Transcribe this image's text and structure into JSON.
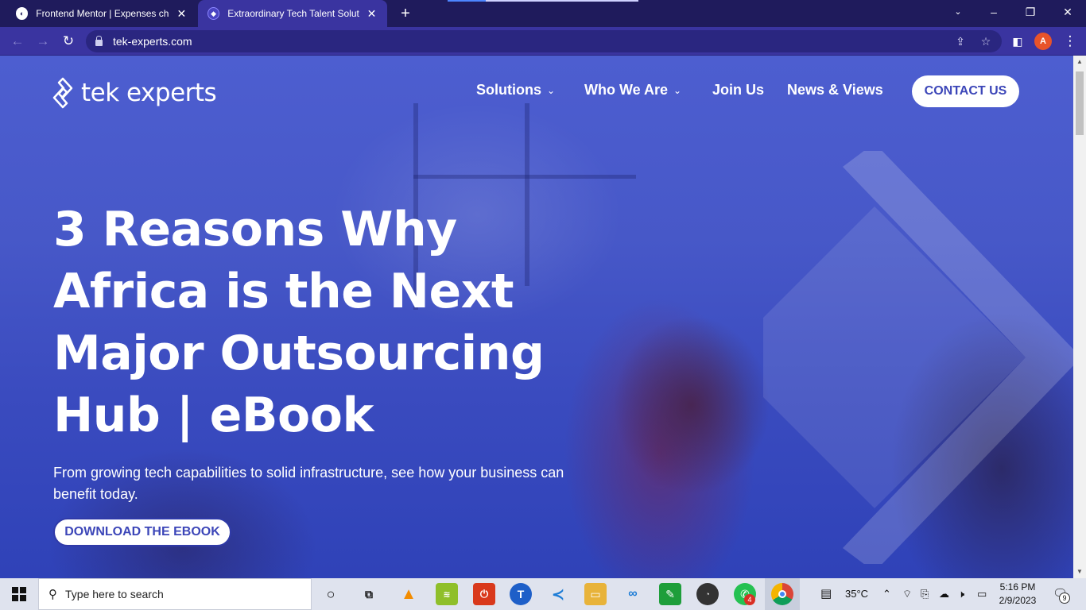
{
  "browser": {
    "tabs": [
      {
        "title": "Frontend Mentor | Expenses char",
        "active": false
      },
      {
        "title": "Extraordinary Tech Talent Solution",
        "active": true
      }
    ],
    "new_tab_label": "+",
    "url": "tek-experts.com",
    "profile_initial": "A",
    "accent_color": "#3a34a0"
  },
  "site": {
    "logo_text": "tek experts",
    "nav": [
      {
        "label": "Solutions",
        "has_dropdown": true
      },
      {
        "label": "Who We Are",
        "has_dropdown": true
      },
      {
        "label": "Join Us",
        "has_dropdown": false
      },
      {
        "label": "News & Views",
        "has_dropdown": false
      }
    ],
    "contact_label": "CONTACT US"
  },
  "hero": {
    "headline_lines": [
      "3 Reasons Why",
      "Africa is the Next",
      "Major Outsourcing",
      "Hub | eBook"
    ],
    "subtext": "From growing tech capabilities to solid infrastructure, see how your business can benefit today.",
    "cta_label": "DOWNLOAD THE EBOOK"
  },
  "taskbar": {
    "search_placeholder": "Type here to search",
    "temperature": "35°C",
    "time": "5:16 PM",
    "date": "2/9/2023",
    "whatsapp_badge": "4",
    "notifications_count": "9"
  }
}
